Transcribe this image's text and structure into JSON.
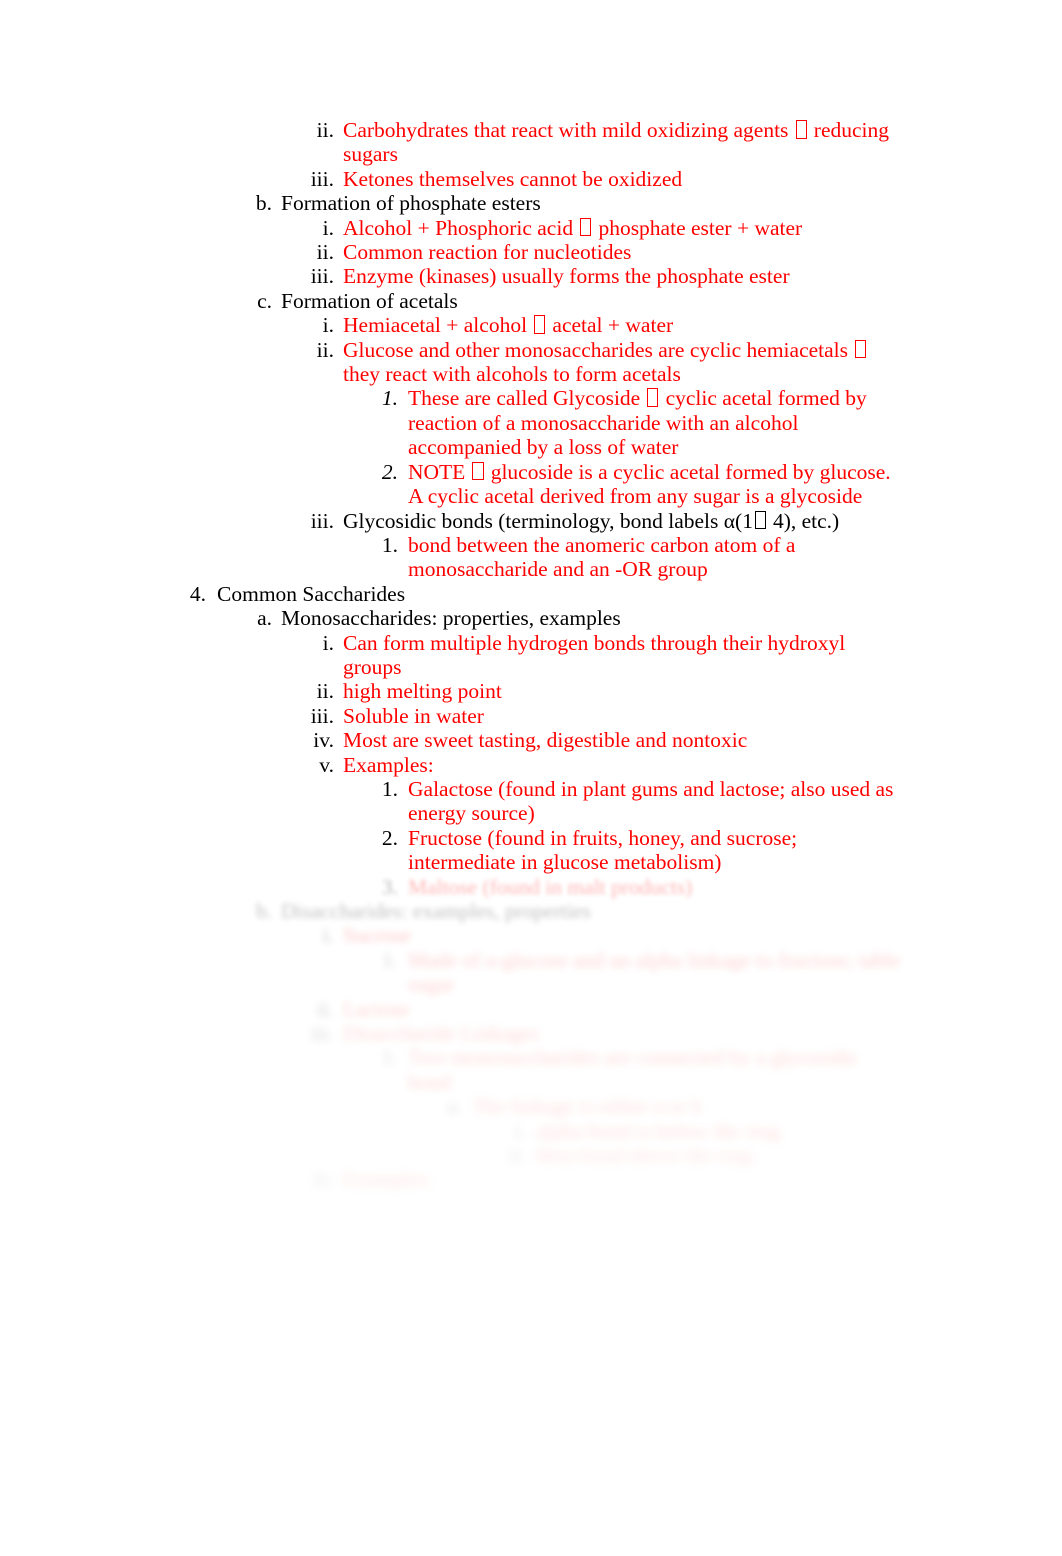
{
  "document": {
    "page_background": "#ffffff",
    "text_color_primary": "#000000",
    "text_color_accent": "#FF0000",
    "missing_glyph": "☐"
  },
  "outline": [
    {
      "id": "l3-ii-reducing-sugars",
      "level": 3,
      "marker": "ii.",
      "color": "red",
      "text_pre": "Carbohydrates that react with mild oxidizing agents ",
      "text_post": " reducing sugars",
      "has_tofu": true
    },
    {
      "id": "l3-iii-ketones",
      "level": 3,
      "marker": "iii.",
      "color": "red",
      "text": "Ketones themselves cannot be oxidized"
    },
    {
      "id": "l2-b-phosphate-esters",
      "level": 2,
      "marker": "b.",
      "color": "black",
      "text": "Formation of phosphate esters"
    },
    {
      "id": "l3-i-alcohol-phosphoric",
      "level": 3,
      "marker": "i.",
      "color": "red",
      "text_pre": "Alcohol + Phosphoric acid ",
      "text_post": " phosphate ester + water",
      "has_tofu": true
    },
    {
      "id": "l3-ii-nucleotides",
      "level": 3,
      "marker": "ii.",
      "color": "red",
      "text": "Common reaction for nucleotides"
    },
    {
      "id": "l3-iii-kinases",
      "level": 3,
      "marker": "iii.",
      "color": "red",
      "text": "Enzyme (kinases) usually forms the phosphate ester"
    },
    {
      "id": "l2-c-acetals",
      "level": 2,
      "marker": "c.",
      "color": "black",
      "text": "Formation of acetals"
    },
    {
      "id": "l3-i-hemiacetal",
      "level": 3,
      "marker": "i.",
      "color": "red",
      "text_pre": "Hemiacetal + alcohol ",
      "text_post": " acetal + water",
      "has_tofu": true
    },
    {
      "id": "l3-ii-glucose-cyclic",
      "level": 3,
      "marker": "ii.",
      "color": "red",
      "text_pre": "Glucose and other monosaccharides are cyclic hemiacetals ",
      "text_post": " they react with alcohols to form acetals",
      "has_tofu": true
    },
    {
      "id": "l4-1-glycoside",
      "level": 4,
      "marker": "1.",
      "marker_italic": true,
      "color": "red",
      "text_pre": "These are called Glycoside ",
      "text_post": " cyclic acetal formed by reaction of a monosaccharide with an alcohol accompanied by a loss of water",
      "has_tofu": true
    },
    {
      "id": "l4-2-note-glucoside",
      "level": 4,
      "marker": "2.",
      "marker_italic": true,
      "color": "red",
      "text_pre": "NOTE ",
      "text_post": " glucoside is a cyclic acetal formed by glucose. A cyclic acetal derived from any sugar is a glycoside",
      "has_tofu": true
    },
    {
      "id": "l3-iii-glycosidic-bonds",
      "level": 3,
      "marker": "iii.",
      "color": "black",
      "text_pre": "Glycosidic bonds (terminology, bond labels α(1",
      "text_post": " 4), etc.)",
      "has_tofu": true
    },
    {
      "id": "l4-1-anomeric-carbon",
      "level": 4,
      "marker": "1.",
      "color": "red",
      "text": "bond between the anomeric carbon atom of a monosaccharide and an -OR group"
    },
    {
      "id": "l1-4-common-saccharides",
      "level": 1,
      "marker": "4.",
      "color": "black",
      "text": "Common Saccharides"
    },
    {
      "id": "l2-a-monosaccharides",
      "level": 2,
      "marker": "a.",
      "color": "black",
      "text": "Monosaccharides: properties, examples"
    },
    {
      "id": "l3-i-hydrogen-bonds",
      "level": 3,
      "marker": "i.",
      "color": "red",
      "text": "Can form multiple hydrogen bonds through their hydroxyl groups"
    },
    {
      "id": "l3-ii-melting-point",
      "level": 3,
      "marker": "ii.",
      "color": "red",
      "text": "high melting point"
    },
    {
      "id": "l3-iii-soluble",
      "level": 3,
      "marker": "iii.",
      "color": "red",
      "text": "Soluble in water"
    },
    {
      "id": "l3-iv-sweet-tasting",
      "level": 3,
      "marker": "iv.",
      "color": "red",
      "text": "Most are sweet tasting, digestible and nontoxic"
    },
    {
      "id": "l3-v-examples",
      "level": 3,
      "marker": "v.",
      "color": "red",
      "text": "Examples:"
    },
    {
      "id": "l4-1-galactose",
      "level": 4,
      "marker": "1.",
      "color": "red",
      "text": "Galactose (found in plant gums and lactose; also used as energy source)"
    },
    {
      "id": "l4-2-fructose",
      "level": 4,
      "marker": "2.",
      "color": "red",
      "text": "Fructose (found in fruits, honey, and sucrose; intermediate in glucose metabolism)"
    },
    {
      "id": "l4-3-redacted",
      "level": 4,
      "marker": "3.",
      "color": "red",
      "fade": 1,
      "text": "Maltose (found in malt products)"
    },
    {
      "id": "l2-b-redacted-heading",
      "level": 2,
      "marker": "b.",
      "color": "black",
      "fade": 2,
      "text": "Disaccharides: examples, properties"
    },
    {
      "id": "l3-i-redacted",
      "level": 3,
      "marker": "i.",
      "color": "red",
      "fade": 3,
      "text": "Sucrose"
    },
    {
      "id": "l4-1-redacted",
      "level": 4,
      "marker": "1.",
      "color": "red",
      "fade": 4,
      "text": "Made of a-glucose and an alpha linkage to fructose; table sugar"
    },
    {
      "id": "l3-ii-redacted",
      "level": 3,
      "marker": "ii.",
      "color": "red",
      "fade": 4,
      "text": "Lactose"
    },
    {
      "id": "l3-iii-redacted",
      "level": 3,
      "marker": "iii.",
      "color": "red",
      "fade": 5,
      "text": "Disaccharide Linkages"
    },
    {
      "id": "l4-1b-redacted",
      "level": 4,
      "marker": "1.",
      "color": "red",
      "fade": 5,
      "text": "Two monosaccharides are connected by a glycosidic bond"
    },
    {
      "id": "l5-a-redacted",
      "level": 5,
      "marker": "a.",
      "color": "red",
      "fade": 6,
      "text": "The linkage is either a or b"
    },
    {
      "id": "l6-i-redacted",
      "level": 6,
      "marker": "i.",
      "color": "red",
      "fade": 6,
      "text": "alpha bond is below the ring"
    },
    {
      "id": "l6-ii-redacted",
      "level": 6,
      "marker": "ii.",
      "color": "red",
      "fade": 7,
      "text": "Beta bond above the ring"
    },
    {
      "id": "l3-iv-redacted",
      "level": 3,
      "marker": "iv.",
      "color": "red",
      "fade": 7,
      "text": "Examples:"
    }
  ]
}
